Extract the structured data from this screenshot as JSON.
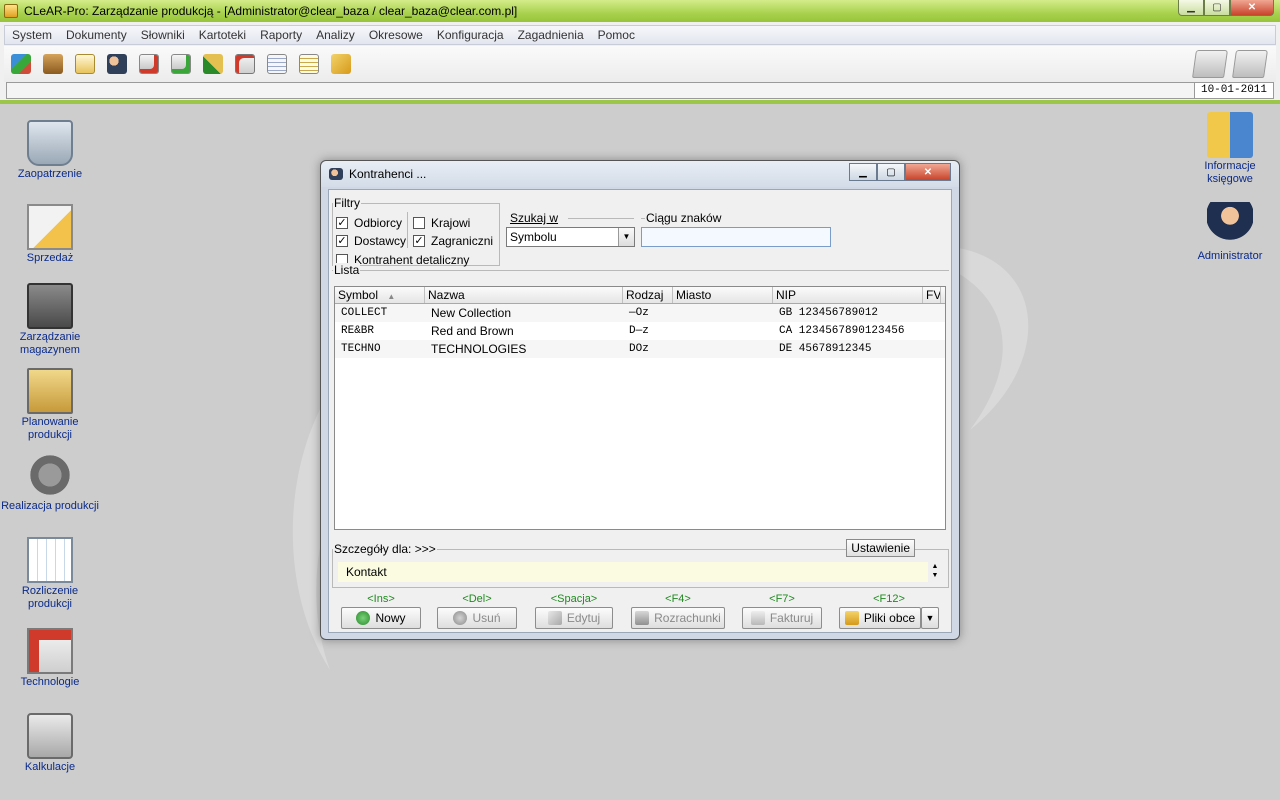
{
  "window": {
    "title": "CLeAR-Pro:  Zarządzanie produkcją - [Administrator@clear_baza / clear_baza@clear.com.pl]"
  },
  "menu": [
    "System",
    "Dokumenty",
    "Słowniki",
    "Kartoteki",
    "Raporty",
    "Analizy",
    "Okresowe",
    "Konfiguracja",
    "Zagadnienia",
    "Pomoc"
  ],
  "toolbar": {
    "icons": [
      "network-icon",
      "box-icon",
      "documents-icon",
      "contractors-icon",
      "document-remove-icon",
      "document-add-icon",
      "tools-icon",
      "calendar-icon",
      "report-icon",
      "report2-icon",
      "help-icon"
    ],
    "right_icons": [
      "printer-add-icon",
      "printer-icon"
    ]
  },
  "status": {
    "date": "10-01-2011"
  },
  "desktop": {
    "left": [
      {
        "name": "zaopatrzenie",
        "label": "Zaopatrzenie"
      },
      {
        "name": "sprzedaz",
        "label": "Sprzedaż"
      },
      {
        "name": "zarzadzanie-magazynem",
        "label": "Zarządzanie magazynem"
      },
      {
        "name": "planowanie-produkcji",
        "label": "Planowanie produkcji"
      },
      {
        "name": "realizacja-produkcji",
        "label": "Realizacja produkcji"
      },
      {
        "name": "rozliczenie-produkcji",
        "label": "Rozliczenie produkcji"
      },
      {
        "name": "technologie",
        "label": "Technologie"
      },
      {
        "name": "kalkulacje",
        "label": "Kalkulacje"
      }
    ],
    "right": [
      {
        "name": "informacje-ksiegowe",
        "label": "Informacje księgowe"
      },
      {
        "name": "administrator",
        "label": "Administrator"
      }
    ]
  },
  "dialog": {
    "title": "Kontrahenci ...",
    "filters": {
      "legend": "Filtry",
      "odbiorcy": {
        "label": "Odbiorcy",
        "checked": true
      },
      "dostawcy": {
        "label": "Dostawcy",
        "checked": true
      },
      "krajowi": {
        "label": "Krajowi",
        "checked": false
      },
      "zagraniczni": {
        "label": "Zagraniczni",
        "checked": true
      },
      "detaliczny": {
        "label": "Kontrahent detaliczny",
        "checked": false
      }
    },
    "search": {
      "in_legend": "Szukaj w",
      "in_value": "Symbolu",
      "string_legend": "Ciągu znaków",
      "string_value": ""
    },
    "list": {
      "legend": "Lista",
      "columns": [
        "Symbol",
        "Nazwa",
        "Rodzaj",
        "Miasto",
        "NIP",
        "FV"
      ],
      "sort_indicator": "▲",
      "rows": [
        {
          "symbol": "COLLECT",
          "nazwa": "New Collection",
          "rodzaj": "—Oz",
          "miasto": "",
          "nip": "GB 123456789012",
          "fv": ""
        },
        {
          "symbol": "RE&BR",
          "nazwa": "Red and Brown",
          "rodzaj": "D—z",
          "miasto": "",
          "nip": "CA 1234567890123456",
          "fv": ""
        },
        {
          "symbol": "TECHNO",
          "nazwa": "TECHNOLOGIES",
          "rodzaj": "DOz",
          "miasto": "",
          "nip": "DE 45678912345",
          "fv": ""
        }
      ]
    },
    "details": {
      "legend": "Szczegóły dla: >>>",
      "settings_button": "Ustawienie",
      "kontakt": "Kontakt"
    },
    "actions": [
      {
        "key": "<Ins>",
        "label": "Nowy",
        "enabled": true,
        "color": "#3aa63a"
      },
      {
        "key": "<Del>",
        "label": "Usuń",
        "enabled": false,
        "color": "#9a9a9a"
      },
      {
        "key": "<Spacja>",
        "label": "Edytuj",
        "enabled": false,
        "color": "#b0b0b0"
      },
      {
        "key": "<F4>",
        "label": "Rozrachunki",
        "enabled": false,
        "color": "#a0a0a0"
      },
      {
        "key": "<F7>",
        "label": "Fakturuj",
        "enabled": false,
        "color": "#b5b5b5"
      },
      {
        "key": "<F12>",
        "label": "Pliki obce",
        "enabled": true,
        "color": "#e0b030"
      }
    ]
  }
}
